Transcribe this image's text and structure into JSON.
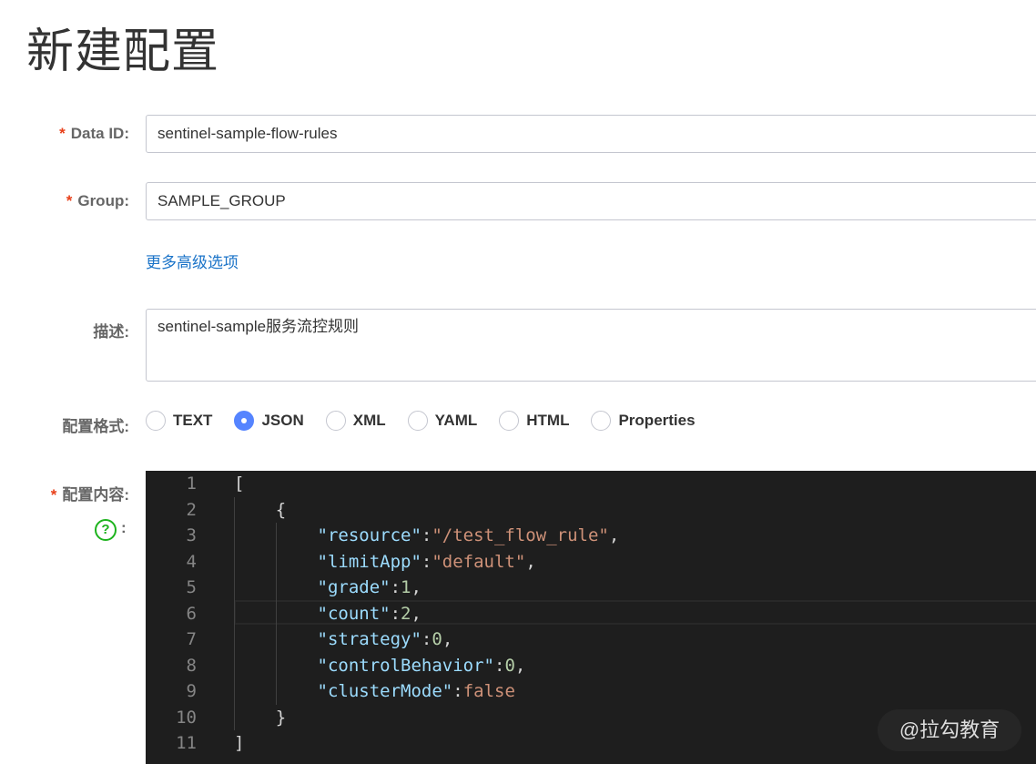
{
  "page_title": "新建配置",
  "form": {
    "data_id": {
      "label": "Data ID:",
      "value": "sentinel-sample-flow-rules",
      "required": "*"
    },
    "group": {
      "label": "Group:",
      "value": "SAMPLE_GROUP",
      "required": "*"
    },
    "advanced_link": "更多高级选项",
    "description": {
      "label": "描述:",
      "value": "sentinel-sample服务流控规则"
    },
    "format": {
      "label": "配置格式:",
      "options": [
        "TEXT",
        "JSON",
        "XML",
        "YAML",
        "HTML",
        "Properties"
      ],
      "selected": "JSON"
    },
    "content": {
      "label": "配置内容:",
      "required": "*",
      "help_icon": "?",
      "help_colon": ":"
    }
  },
  "editor": {
    "line_numbers": [
      "1",
      "2",
      "3",
      "4",
      "5",
      "6",
      "7",
      "8",
      "9",
      "10",
      "11"
    ],
    "lines": [
      {
        "indent": 0,
        "tokens": [
          {
            "t": "p",
            "v": "["
          }
        ]
      },
      {
        "indent": 1,
        "tokens": [
          {
            "t": "p",
            "v": "{"
          }
        ]
      },
      {
        "indent": 2,
        "tokens": [
          {
            "t": "k",
            "v": "\"resource\""
          },
          {
            "t": "p",
            "v": ":"
          },
          {
            "t": "s",
            "v": "\"/test_flow_rule\""
          },
          {
            "t": "p",
            "v": ","
          }
        ]
      },
      {
        "indent": 2,
        "tokens": [
          {
            "t": "k",
            "v": "\"limitApp\""
          },
          {
            "t": "p",
            "v": ":"
          },
          {
            "t": "s",
            "v": "\"default\""
          },
          {
            "t": "p",
            "v": ","
          }
        ]
      },
      {
        "indent": 2,
        "tokens": [
          {
            "t": "k",
            "v": "\"grade\""
          },
          {
            "t": "p",
            "v": ":"
          },
          {
            "t": "n",
            "v": "1"
          },
          {
            "t": "p",
            "v": ","
          }
        ]
      },
      {
        "indent": 2,
        "tokens": [
          {
            "t": "k",
            "v": "\"count\""
          },
          {
            "t": "p",
            "v": ":"
          },
          {
            "t": "n",
            "v": "2"
          },
          {
            "t": "p",
            "v": ","
          }
        ]
      },
      {
        "indent": 2,
        "tokens": [
          {
            "t": "k",
            "v": "\"strategy\""
          },
          {
            "t": "p",
            "v": ":"
          },
          {
            "t": "n",
            "v": "0"
          },
          {
            "t": "p",
            "v": ","
          }
        ]
      },
      {
        "indent": 2,
        "tokens": [
          {
            "t": "k",
            "v": "\"controlBehavior\""
          },
          {
            "t": "p",
            "v": ":"
          },
          {
            "t": "n",
            "v": "0"
          },
          {
            "t": "p",
            "v": ","
          }
        ]
      },
      {
        "indent": 2,
        "tokens": [
          {
            "t": "k",
            "v": "\"clusterMode\""
          },
          {
            "t": "p",
            "v": ":"
          },
          {
            "t": "s",
            "v": "false"
          }
        ]
      },
      {
        "indent": 1,
        "tokens": [
          {
            "t": "p",
            "v": "}"
          }
        ]
      },
      {
        "indent": 0,
        "tokens": [
          {
            "t": "p",
            "v": "]"
          }
        ]
      }
    ],
    "current_line": "6"
  },
  "watermark": "@拉勾教育",
  "colors": {
    "accent": "#5584ff",
    "link": "#1a73c8",
    "required": "#e8401a",
    "help": "#1db31d",
    "editor_bg": "#1e1e1e"
  }
}
